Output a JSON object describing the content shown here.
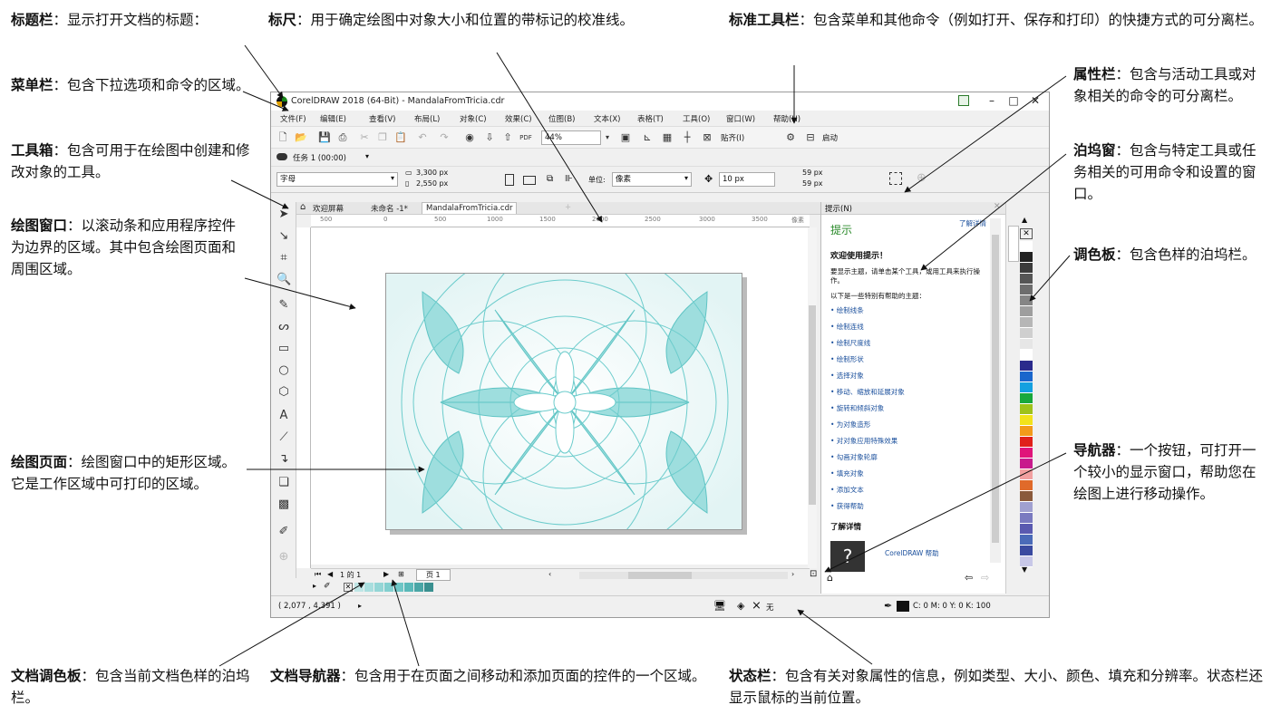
{
  "callouts": {
    "titlebar": {
      "term": "标题栏",
      "desc": "：显示打开文档的标题："
    },
    "menubar": {
      "term": "菜单栏",
      "desc": "：包含下拉选项和命令的区域。"
    },
    "toolbox": {
      "term": "工具箱",
      "desc": "：包含可用于在绘图中创建和修改对象的工具。"
    },
    "drawing_window": {
      "term": "绘图窗口",
      "desc": "：以滚动条和应用程序控件为边界的区域。其中包含绘图页面和周围区域。"
    },
    "drawing_page": {
      "term": "绘图页面",
      "desc": "：绘图窗口中的矩形区域。它是工作区域中可打印的区域。"
    },
    "rulers": {
      "term": "标尺",
      "desc": "：用于确定绘图中对象大小和位置的带标记的校准线。"
    },
    "standard_toolbar": {
      "term": "标准工具栏",
      "desc": "：包含菜单和其他命令（例如打开、保存和打印）的快捷方式的可分离栏。"
    },
    "property_bar": {
      "term": "属性栏",
      "desc": "：包含与活动工具或对象相关的命令的可分离栏。"
    },
    "docker": {
      "term": "泊坞窗",
      "desc": "：包含与特定工具或任务相关的可用命令和设置的窗口。"
    },
    "color_palette": {
      "term": "调色板",
      "desc": "：包含色样的泊坞栏。"
    },
    "navigator": {
      "term": "导航器",
      "desc": "：一个按钮，可打开一个较小的显示窗口，帮助您在绘图上进行移动操作。"
    },
    "document_palette": {
      "term": "文档调色板",
      "desc": "：包含当前文档色样的泊坞栏。"
    },
    "document_navigator": {
      "term": "文档导航器",
      "desc": "：包含用于在页面之间移动和添加页面的控件的一个区域。"
    },
    "status_bar": {
      "term": "状态栏",
      "desc": "：包含有关对象属性的信息，例如类型、大小、颜色、填充和分辨率。状态栏还显示鼠标的当前位置。"
    }
  },
  "app": {
    "window_title": "CorelDRAW 2018 (64-Bit) - MandalaFromTricia.cdr",
    "menu": [
      "文件(F)",
      "编辑(E)",
      "查看(V)",
      "布局(L)",
      "对象(C)",
      "效果(C)",
      "位图(B)",
      "文本(X)",
      "表格(T)",
      "工具(O)",
      "窗口(W)",
      "帮助(H)"
    ],
    "toolbar": {
      "zoom": "44%",
      "snap": "贴齐(I)",
      "launch": "启动"
    },
    "task": "任务 1 (00:00)",
    "propbar": {
      "paper": "字母",
      "width": "3,300 px",
      "height": "2,550 px",
      "units_label": "单位:",
      "units_value": "像素",
      "nudge": "10 px",
      "dup_x": "59 px",
      "dup_y": "59 px"
    },
    "tabs": {
      "welcome": "欢迎屏幕",
      "untitled": "未命名 -1*",
      "active": "MandalaFromTricia.cdr"
    },
    "ruler": {
      "labels": [
        "500",
        "0",
        "500",
        "1000",
        "1500",
        "2000",
        "2500",
        "3000",
        "3500"
      ],
      "unit": "像素"
    },
    "docnav": {
      "pages": "1 的 1",
      "page_tab": "页 1"
    },
    "status": {
      "coords": "( 2,077 , 4,391 )",
      "fill_none": "无",
      "outline": "C: 0 M: 0 Y: 0 K: 100"
    },
    "docker": {
      "header": "提示(N)",
      "title": "提示",
      "learn_more_link": "了解详情",
      "welcome": "欢迎使用提示！",
      "intro": "要显示主题，请单击某个工具，或用工具来执行操作。",
      "helpful": "以下是一些特别有帮助的主题：",
      "topics": [
        "• 绘制线条",
        "• 绘制连线",
        "• 绘制尺度线",
        "• 绘制形状",
        "• 选择对象",
        "• 移动、缩放和延展对象",
        "• 旋转和倾斜对象",
        "• 为对象造形",
        "• 对对象应用特殊效果",
        "• 勾画对象轮廓",
        "• 填充对象",
        "• 添加文本",
        "• 获得帮助"
      ],
      "learn_more": "了解详情",
      "help_badge": "?",
      "help": "CorelDRAW 帮助"
    },
    "palette_colors": [
      "#ffffff",
      "#222222",
      "#3c3c3c",
      "#555555",
      "#6d6d6d",
      "#858585",
      "#9e9e9e",
      "#b6b6b6",
      "#cfcfcf",
      "#e6e6e6",
      "#ffffff",
      "#2a2a8c",
      "#1a66cc",
      "#14a0e0",
      "#18a83c",
      "#9ec21a",
      "#f2e21a",
      "#f29a1a",
      "#e0201a",
      "#e0147a",
      "#c81a8c",
      "#f2a0a0",
      "#e06a2a",
      "#8a5a3c",
      "#a0a0d0",
      "#7a7ac0",
      "#5a5ab0",
      "#4a6ab8",
      "#3a4aa0",
      "#c8c8e8"
    ],
    "doc_colors": [
      "#bfe6e6",
      "#a8dede",
      "#94d6d6",
      "#82cfcf",
      "#6ec6c6",
      "#5ab9b9",
      "#4aa6a6",
      "#3a9090"
    ]
  }
}
